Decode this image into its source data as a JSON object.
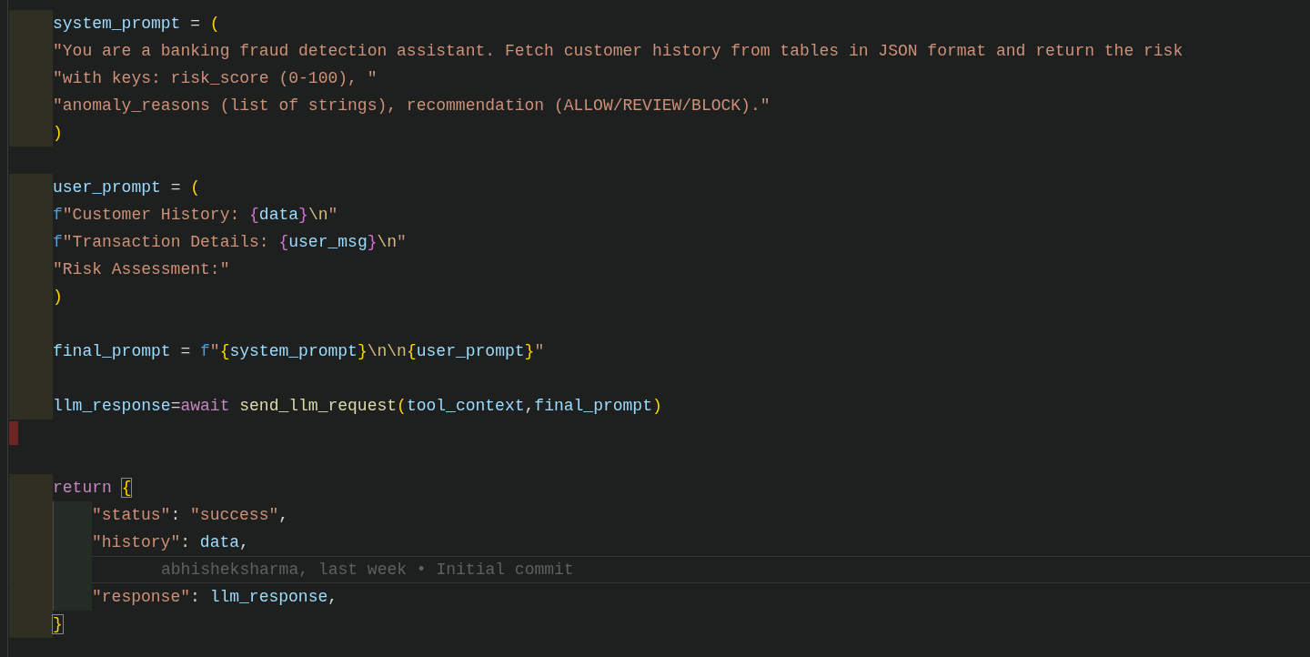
{
  "lines": [
    {
      "added": true,
      "deleted": false,
      "indent": false,
      "current": false,
      "tokens": [
        {
          "kind": "var",
          "text": "system_prompt"
        },
        {
          "kind": "op",
          "text": " = "
        },
        {
          "kind": "paren",
          "text": "("
        }
      ]
    },
    {
      "added": true,
      "deleted": false,
      "indent": false,
      "current": false,
      "tokens": [
        {
          "kind": "str",
          "text": "\"You are a banking fraud detection assistant. Fetch customer history from tables in JSON format and return the risk"
        }
      ]
    },
    {
      "added": true,
      "deleted": false,
      "indent": false,
      "current": false,
      "tokens": [
        {
          "kind": "str",
          "text": "\"with keys: risk_score (0-100), \""
        }
      ]
    },
    {
      "added": true,
      "deleted": false,
      "indent": false,
      "current": false,
      "tokens": [
        {
          "kind": "str",
          "text": "\"anomaly_reasons (list of strings), recommendation (ALLOW/REVIEW/BLOCK).\""
        }
      ]
    },
    {
      "added": true,
      "deleted": false,
      "indent": false,
      "current": false,
      "tokens": [
        {
          "kind": "paren",
          "text": ")"
        }
      ]
    },
    {
      "added": false,
      "deleted": false,
      "indent": false,
      "current": false
    },
    {
      "added": true,
      "deleted": false,
      "indent": false,
      "current": false,
      "tokens": [
        {
          "kind": "var",
          "text": "user_prompt"
        },
        {
          "kind": "op",
          "text": " = "
        },
        {
          "kind": "paren",
          "text": "("
        }
      ]
    },
    {
      "added": true,
      "deleted": false,
      "indent": false,
      "current": false,
      "tokens": [
        {
          "kind": "fprefix",
          "text": "f"
        },
        {
          "kind": "str",
          "text": "\"Customer History: "
        },
        {
          "kind": "interp",
          "text": "{"
        },
        {
          "kind": "var",
          "text": "data"
        },
        {
          "kind": "interp",
          "text": "}"
        },
        {
          "kind": "esc",
          "text": "\\n"
        },
        {
          "kind": "str",
          "text": "\""
        }
      ]
    },
    {
      "added": true,
      "deleted": false,
      "indent": false,
      "current": false,
      "tokens": [
        {
          "kind": "fprefix",
          "text": "f"
        },
        {
          "kind": "str",
          "text": "\"Transaction Details: "
        },
        {
          "kind": "interp",
          "text": "{"
        },
        {
          "kind": "var",
          "text": "user_msg"
        },
        {
          "kind": "interp",
          "text": "}"
        },
        {
          "kind": "esc",
          "text": "\\n"
        },
        {
          "kind": "str",
          "text": "\""
        }
      ]
    },
    {
      "added": true,
      "deleted": false,
      "indent": false,
      "current": false,
      "tokens": [
        {
          "kind": "str",
          "text": "\"Risk Assessment:\""
        }
      ]
    },
    {
      "added": true,
      "deleted": false,
      "indent": false,
      "current": false,
      "tokens": [
        {
          "kind": "paren",
          "text": ")"
        }
      ]
    },
    {
      "added": true,
      "deleted": false,
      "indent": false,
      "current": false
    },
    {
      "added": true,
      "deleted": false,
      "indent": false,
      "current": false,
      "tokens": [
        {
          "kind": "var",
          "text": "final_prompt"
        },
        {
          "kind": "op",
          "text": " = "
        },
        {
          "kind": "fprefix",
          "text": "f"
        },
        {
          "kind": "str",
          "text": "\""
        },
        {
          "kind": "paren",
          "text": "{"
        },
        {
          "kind": "var",
          "text": "system_prompt"
        },
        {
          "kind": "paren",
          "text": "}"
        },
        {
          "kind": "esc",
          "text": "\\n\\n"
        },
        {
          "kind": "paren",
          "text": "{"
        },
        {
          "kind": "var",
          "text": "user_prompt"
        },
        {
          "kind": "paren",
          "text": "}"
        },
        {
          "kind": "str",
          "text": "\""
        }
      ]
    },
    {
      "added": true,
      "deleted": false,
      "indent": false,
      "current": false
    },
    {
      "added": true,
      "deleted": false,
      "indent": false,
      "current": false,
      "tokens": [
        {
          "kind": "var",
          "text": "llm_response"
        },
        {
          "kind": "op",
          "text": "="
        },
        {
          "kind": "keyword",
          "text": "await "
        },
        {
          "kind": "func",
          "text": "send_llm_request"
        },
        {
          "kind": "paren",
          "text": "("
        },
        {
          "kind": "var",
          "text": "tool_context"
        },
        {
          "kind": "op",
          "text": ","
        },
        {
          "kind": "var",
          "text": "final_prompt"
        },
        {
          "kind": "paren",
          "text": ")"
        }
      ]
    },
    {
      "added": false,
      "deleted": true,
      "indent": false,
      "current": false
    },
    {
      "added": false,
      "deleted": false,
      "indent": false,
      "current": false
    },
    {
      "added": true,
      "deleted": false,
      "indent": false,
      "current": false,
      "tokens": [
        {
          "kind": "keyword",
          "text": "return "
        },
        {
          "kind": "matched",
          "text": "{"
        }
      ]
    },
    {
      "added": true,
      "deleted": false,
      "indent": true,
      "current": false,
      "tokens": [
        {
          "kind": "str",
          "text": "\"status\""
        },
        {
          "kind": "op",
          "text": ": "
        },
        {
          "kind": "str",
          "text": "\"success\""
        },
        {
          "kind": "op",
          "text": ","
        }
      ]
    },
    {
      "added": true,
      "deleted": false,
      "indent": true,
      "current": false,
      "tokens": [
        {
          "kind": "str",
          "text": "\"history\""
        },
        {
          "kind": "op",
          "text": ": "
        },
        {
          "kind": "var",
          "text": "data"
        },
        {
          "kind": "op",
          "text": ","
        }
      ]
    },
    {
      "added": true,
      "deleted": false,
      "indent": true,
      "current": true,
      "blame": "abhisheksharma, last week • Initial commit"
    },
    {
      "added": true,
      "deleted": false,
      "indent": true,
      "current": false,
      "tokens": [
        {
          "kind": "str",
          "text": "\"response\""
        },
        {
          "kind": "op",
          "text": ": "
        },
        {
          "kind": "var",
          "text": "llm_response"
        },
        {
          "kind": "op",
          "text": ","
        }
      ]
    },
    {
      "added": true,
      "deleted": false,
      "indent": false,
      "current": false,
      "tokens": [
        {
          "kind": "matched",
          "text": "}"
        }
      ]
    }
  ]
}
